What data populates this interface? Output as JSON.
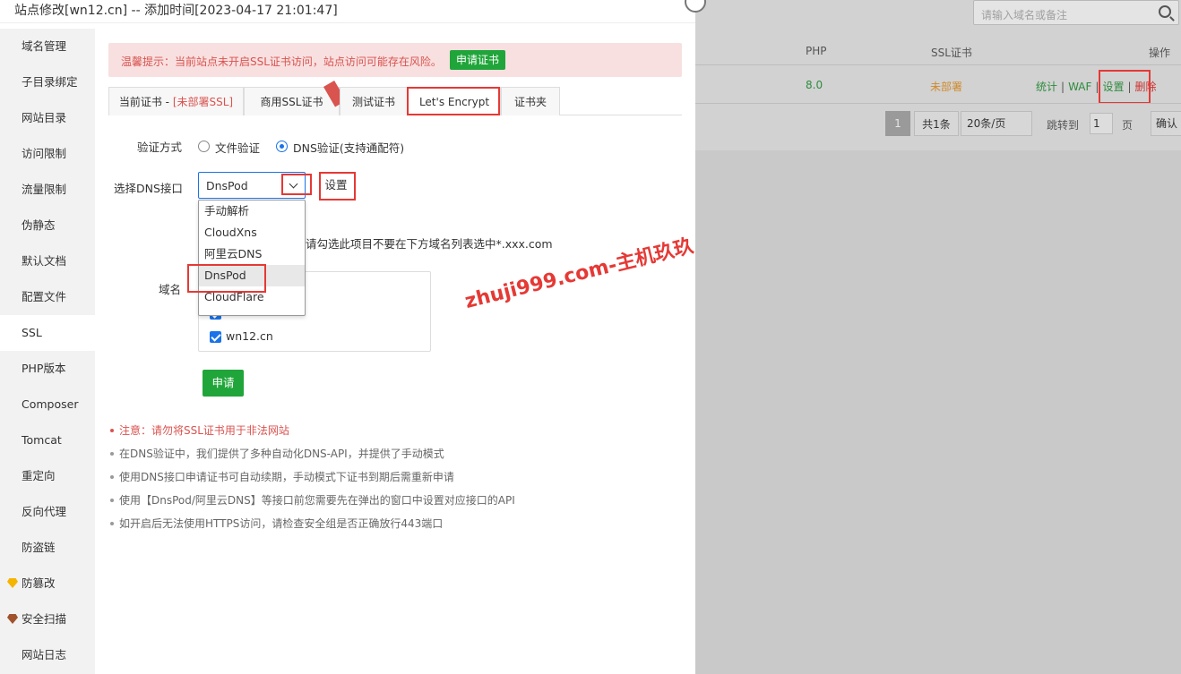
{
  "dialog": {
    "title": "站点修改[wn12.cn] -- 添加时间[2023-04-17 21:01:47]"
  },
  "sidebar": {
    "items": [
      {
        "label": "域名管理"
      },
      {
        "label": "子目录绑定"
      },
      {
        "label": "网站目录"
      },
      {
        "label": "访问限制"
      },
      {
        "label": "流量限制"
      },
      {
        "label": "伪静态"
      },
      {
        "label": "默认文档"
      },
      {
        "label": "配置文件"
      },
      {
        "label": "SSL"
      },
      {
        "label": "PHP版本"
      },
      {
        "label": "Composer"
      },
      {
        "label": "Tomcat"
      },
      {
        "label": "重定向"
      },
      {
        "label": "反向代理"
      },
      {
        "label": "防盗链"
      },
      {
        "label": "防篡改"
      },
      {
        "label": "安全扫描"
      },
      {
        "label": "网站日志"
      }
    ],
    "active": "SSL"
  },
  "alert": {
    "text": "温馨提示：当前站点未开启SSL证书访问，站点访问可能存在风险。",
    "button": "申请证书"
  },
  "tabs": {
    "current_prefix": "当前证书 - ",
    "current_status": "[未部署SSL]",
    "commercial": "商用SSL证书",
    "test": "测试证书",
    "letsencrypt": "Let's Encrypt",
    "folder": "证书夹"
  },
  "verify": {
    "label": "验证方式",
    "option_file": "文件验证",
    "option_dns": "DNS验证(支持通配符)",
    "selected": "DNS验证(支持通配符)"
  },
  "dns": {
    "label": "选择DNS接口",
    "value": "DnsPod",
    "set_button": "设置",
    "options": [
      "手动解析",
      "CloudXns",
      "阿里云DNS",
      "DnsPod",
      "CloudFlare"
    ],
    "hint": "请勾选此项目不要在下方域名列表选中*.xxx.com"
  },
  "domain": {
    "label": "域名",
    "items": [
      "wn12.cn"
    ]
  },
  "apply_button": "申请",
  "notes": [
    "注意：请勿将SSL证书用于非法网站",
    "在DNS验证中，我们提供了多种自动化DNS-API，并提供了手动模式",
    "使用DNS接口申请证书可自动续期，手动模式下证书到期后需重新申请",
    "使用【DnsPod/阿里云DNS】等接口前您需要先在弹出的窗口中设置对应接口的API",
    "如开启后无法使用HTTPS访问，请检查安全组是否正确放行443端口"
  ],
  "watermark": "zhuji999.com-主机玖玖",
  "background": {
    "search_placeholder": "请输入域名或备注",
    "col_php": "PHP",
    "col_ssl": "SSL证书",
    "col_ops": "操作",
    "row_php": "8.0",
    "row_ssl": "未部署",
    "actions": [
      "统计",
      "WAF",
      "设置",
      "删除"
    ],
    "pager_page": "1",
    "pager_total": "共1条",
    "pager_size": "20条/页",
    "pager_jump": "跳转到",
    "pager_input": "1",
    "pager_page_unit": "页",
    "pager_ok": "确认"
  },
  "colors": {
    "accent_green": "#20a53a",
    "alert_red": "#d9534f",
    "focus_blue": "#1a73e8",
    "annotation_red": "#e53935"
  }
}
